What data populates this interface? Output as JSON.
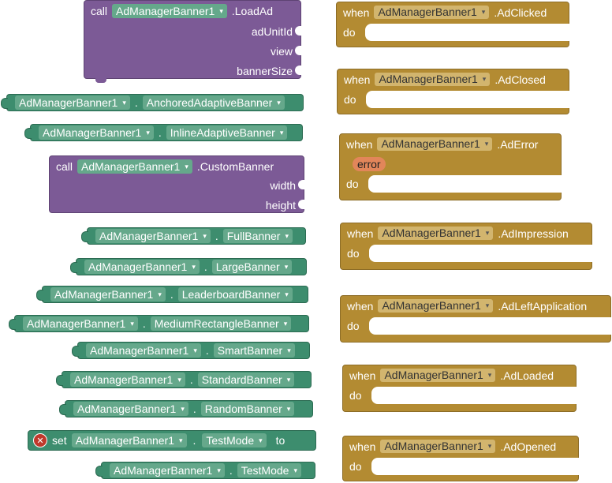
{
  "component": "AdManagerBanner1",
  "colors": {
    "procedure": "#7c5a96",
    "property": "#3d8d6e",
    "event": "#b38b32",
    "error": "#c0392b",
    "param": "#e2865a"
  },
  "call_loadad": {
    "call_word": "call",
    "component": "AdManagerBanner1",
    "method": ".LoadAd",
    "args": [
      "adUnitId",
      "view",
      "bannerSize"
    ]
  },
  "call_custombanner": {
    "call_word": "call",
    "component": "AdManagerBanner1",
    "method": ".CustomBanner",
    "args": [
      "width",
      "height"
    ]
  },
  "getters": [
    {
      "component": "AdManagerBanner1",
      "property": "AnchoredAdaptiveBanner"
    },
    {
      "component": "AdManagerBanner1",
      "property": "InlineAdaptiveBanner"
    },
    {
      "component": "AdManagerBanner1",
      "property": "FullBanner"
    },
    {
      "component": "AdManagerBanner1",
      "property": "LargeBanner"
    },
    {
      "component": "AdManagerBanner1",
      "property": "LeaderboardBanner"
    },
    {
      "component": "AdManagerBanner1",
      "property": "MediumRectangleBanner"
    },
    {
      "component": "AdManagerBanner1",
      "property": "SmartBanner"
    },
    {
      "component": "AdManagerBanner1",
      "property": "StandardBanner"
    },
    {
      "component": "AdManagerBanner1",
      "property": "RandomBanner"
    },
    {
      "component": "AdManagerBanner1",
      "property": "TestMode"
    }
  ],
  "setter": {
    "set_word": "set",
    "component": "AdManagerBanner1",
    "property": "TestMode",
    "to_word": "to"
  },
  "events": [
    {
      "when": "when",
      "component": "AdManagerBanner1",
      "event": ".AdClicked",
      "do": "do"
    },
    {
      "when": "when",
      "component": "AdManagerBanner1",
      "event": ".AdClosed",
      "do": "do"
    },
    {
      "when": "when",
      "component": "AdManagerBanner1",
      "event": ".AdError",
      "param": "error",
      "do": "do"
    },
    {
      "when": "when",
      "component": "AdManagerBanner1",
      "event": ".AdImpression",
      "do": "do"
    },
    {
      "when": "when",
      "component": "AdManagerBanner1",
      "event": ".AdLeftApplication",
      "do": "do"
    },
    {
      "when": "when",
      "component": "AdManagerBanner1",
      "event": ".AdLoaded",
      "do": "do"
    },
    {
      "when": "when",
      "component": "AdManagerBanner1",
      "event": ".AdOpened",
      "do": "do"
    }
  ],
  "dropdown_arrow": "▾",
  "dot": ".",
  "error_icon_glyph": "✕"
}
